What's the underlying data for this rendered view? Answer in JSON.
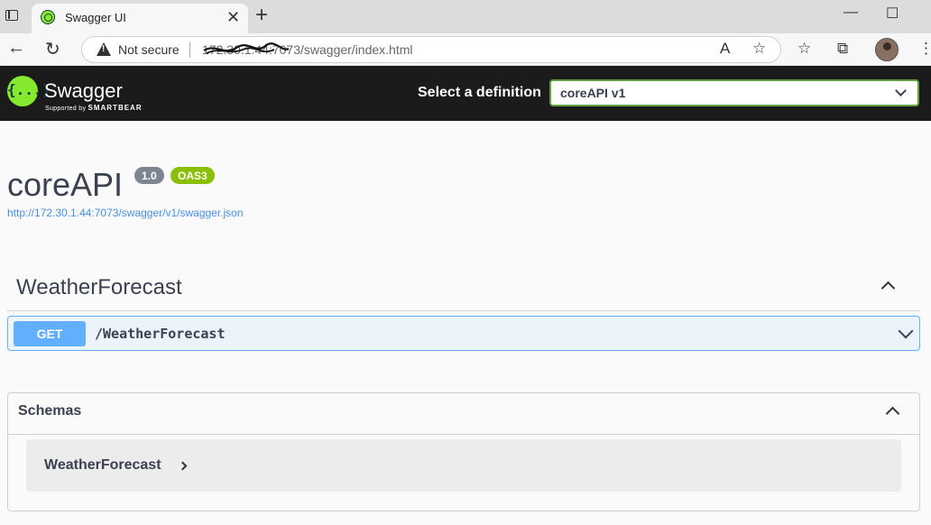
{
  "browser": {
    "tab_title": "Swagger UI",
    "tab_close": "✕",
    "new_tab": "+",
    "not_secure": "Not secure",
    "url": "172.30.1.44:7073/swagger/index.html"
  },
  "topbar": {
    "logo_text": "Swagger",
    "logo_glyph": "{...}",
    "logo_supported": "Supported by",
    "logo_brand": "SMARTBEAR",
    "select_label": "Select a definition",
    "select_value": "coreAPI v1"
  },
  "info": {
    "title": "coreAPI",
    "version": "1.0",
    "oas": "OAS3",
    "spec_url": "http://172.30.1.44:7073/swagger/v1/swagger.json"
  },
  "tag": {
    "name": "WeatherForecast",
    "operations": [
      {
        "method": "GET",
        "path": "/WeatherForecast"
      }
    ]
  },
  "schemas": {
    "title": "Schemas",
    "models": [
      "WeatherForecast"
    ]
  },
  "colors": {
    "topbar_bg": "#1b1b1b",
    "swagger_green": "#85ea2d",
    "get_blue": "#61affe",
    "oas_green": "#89bf04",
    "link_blue": "#4990e2"
  }
}
